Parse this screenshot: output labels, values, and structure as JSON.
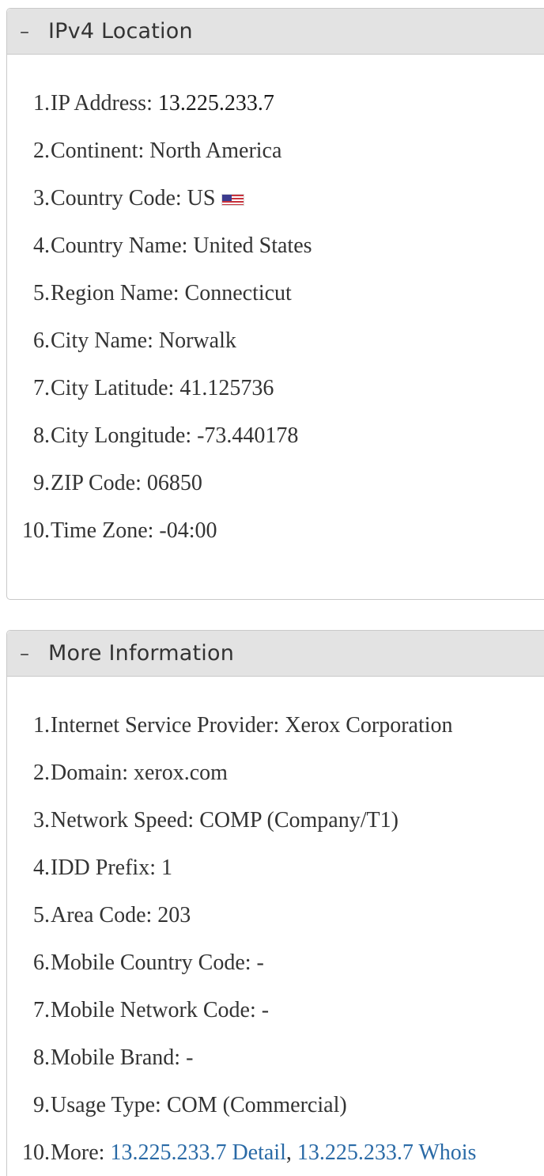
{
  "panels": [
    {
      "toggle": "–",
      "title": "IPv4 Location",
      "items": [
        {
          "num": "1.",
          "label": "IP Address:",
          "value": "13.225.233.7"
        },
        {
          "num": "2.",
          "label": "Continent:",
          "value": "North America"
        },
        {
          "num": "3.",
          "label": "Country Code:",
          "value": "US",
          "icon": "us-flag-icon"
        },
        {
          "num": "4.",
          "label": "Country Name:",
          "value": "United States"
        },
        {
          "num": "5.",
          "label": "Region Name:",
          "value": "Connecticut"
        },
        {
          "num": "6.",
          "label": "City Name:",
          "value": "Norwalk"
        },
        {
          "num": "7.",
          "label": "City Latitude:",
          "value": "41.125736"
        },
        {
          "num": "8.",
          "label": "City Longitude:",
          "value": "-73.440178"
        },
        {
          "num": "9.",
          "label": "ZIP Code:",
          "value": "06850"
        },
        {
          "num": "10.",
          "label": "Time Zone:",
          "value": "-04:00"
        }
      ]
    },
    {
      "toggle": "–",
      "title": "More Information",
      "items": [
        {
          "num": "1.",
          "label": "Internet Service Provider:",
          "value": "Xerox Corporation"
        },
        {
          "num": "2.",
          "label": "Domain:",
          "value": "xerox.com"
        },
        {
          "num": "3.",
          "label": "Network Speed:",
          "value": "COMP (Company/T1)"
        },
        {
          "num": "4.",
          "label": "IDD Prefix:",
          "value": "1"
        },
        {
          "num": "5.",
          "label": "Area Code:",
          "value": "203"
        },
        {
          "num": "6.",
          "label": "Mobile Country Code:",
          "value": "-"
        },
        {
          "num": "7.",
          "label": "Mobile Network Code:",
          "value": "-"
        },
        {
          "num": "8.",
          "label": "Mobile Brand:",
          "value": "-"
        },
        {
          "num": "9.",
          "label": "Usage Type:",
          "value": "COM (Commercial)"
        },
        {
          "num": "10.",
          "label": "More:",
          "links": [
            "13.225.233.7 Detail",
            "13.225.233.7 Whois"
          ],
          "separator": ","
        }
      ]
    }
  ],
  "colors": {
    "header_bg": "#e3e3e3",
    "border": "#c9c9c9",
    "text": "#333333",
    "link": "#2a6aa6"
  }
}
